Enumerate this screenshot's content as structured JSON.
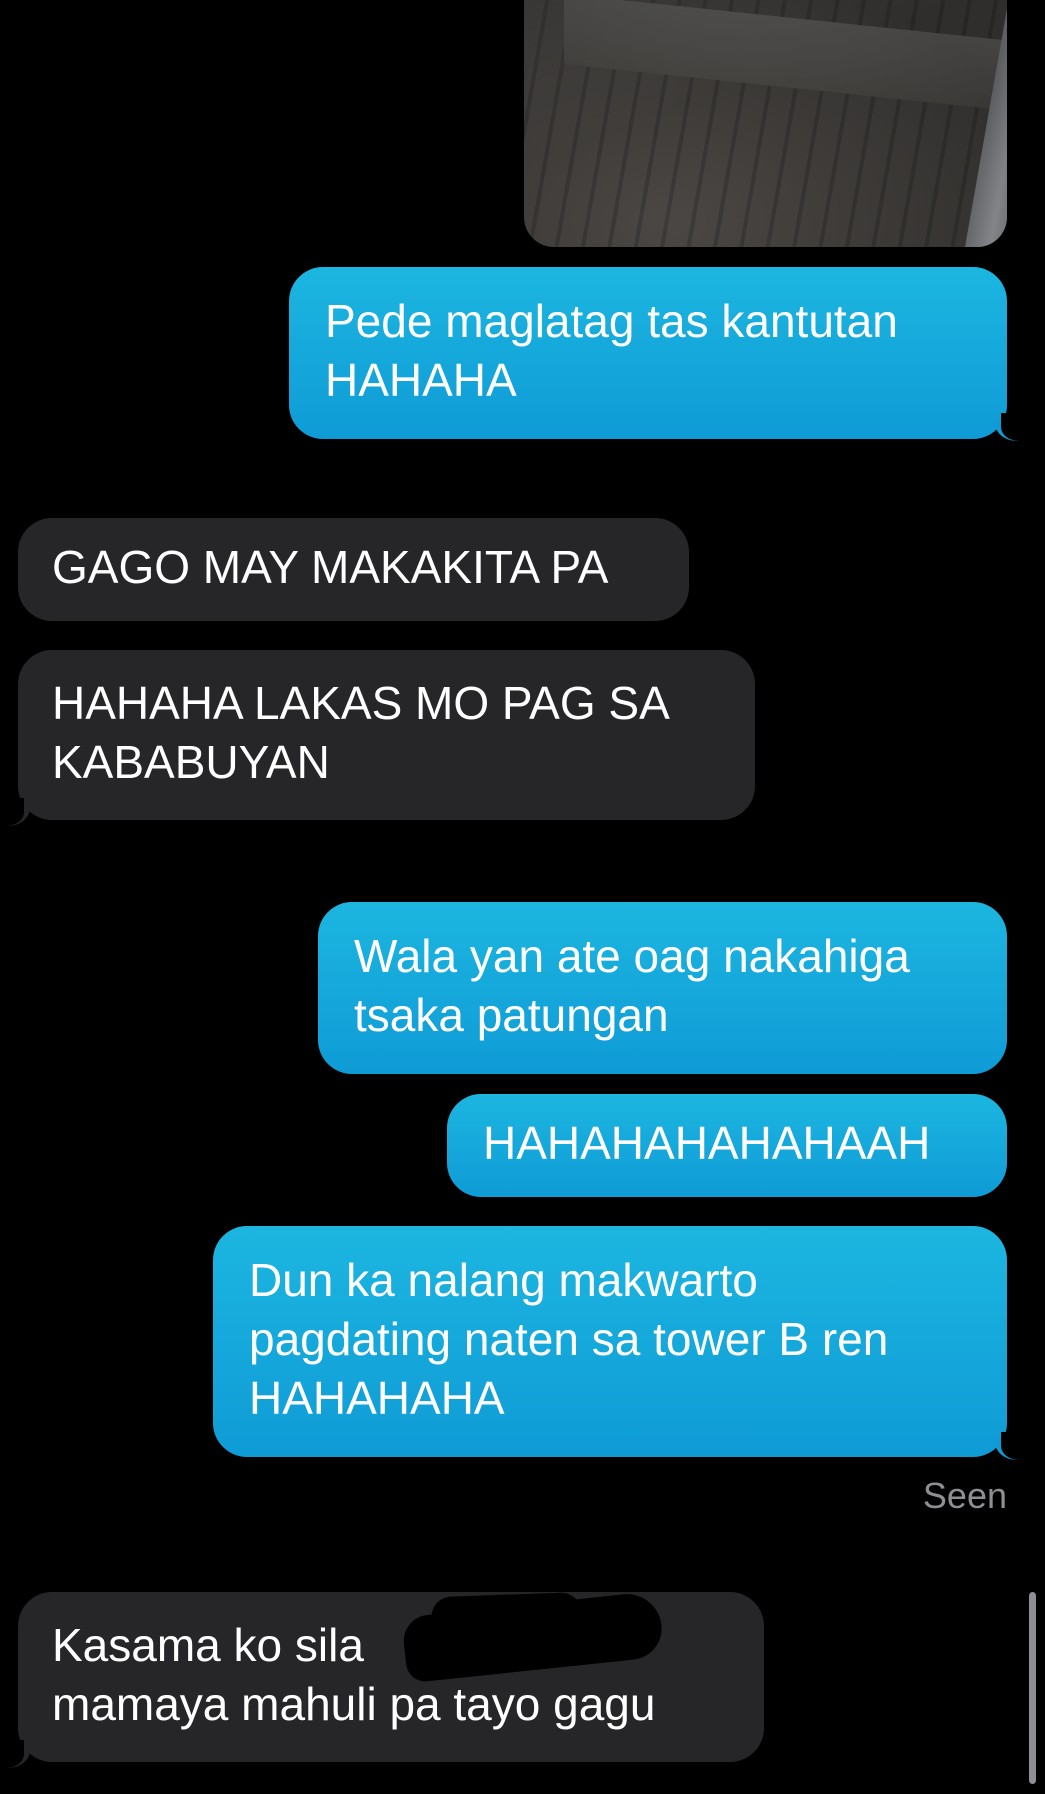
{
  "conversation": {
    "photo_attachment": "photo-of-tiled-floor-corner",
    "messages": [
      {
        "side": "out",
        "text": "Pede maglatag tas kantutan\nHAHAHA"
      },
      {
        "side": "in",
        "text": "GAGO MAY MAKAKITA PA"
      },
      {
        "side": "in",
        "text": "HAHAHA LAKAS MO PAG SA\nKABABUYAN"
      },
      {
        "side": "out",
        "text": "Wala yan ate oag nakahiga\ntsaka patungan"
      },
      {
        "side": "out",
        "text": "HAHAHAHAHAHAAH"
      },
      {
        "side": "out",
        "text": "Dun ka nalang makwarto\npagdating naten sa tower B ren\nHAHAHAHA"
      },
      {
        "side": "in",
        "text": "Kasama ko sila\nmamaya mahuli pa tayo gagu"
      }
    ],
    "read_status": "Seen"
  },
  "colors": {
    "background": "#000000",
    "outgoing_bubble": "#12a7da",
    "incoming_bubble": "#262628",
    "status_text": "#8e8e93"
  }
}
